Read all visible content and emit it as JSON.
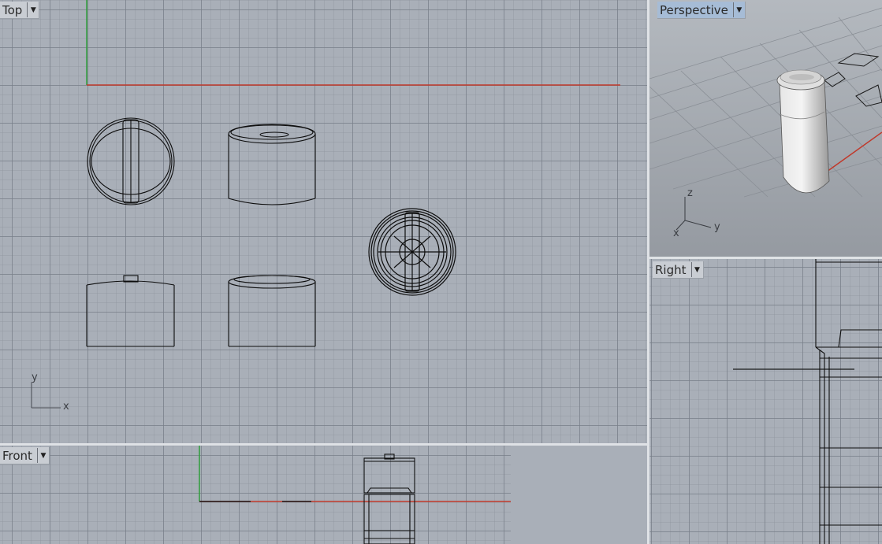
{
  "viewports": {
    "top": {
      "label": "Top",
      "axis_x": "x",
      "axis_y": "y"
    },
    "front": {
      "label": "Front"
    },
    "perspective": {
      "label": "Perspective",
      "axis_x": "x",
      "axis_y": "y",
      "axis_z": "z"
    },
    "right": {
      "label": "Right"
    }
  },
  "icons": {
    "dropdown": "dropdown-arrow-icon"
  },
  "colors": {
    "x_axis": "#c0392b",
    "y_axis": "#2e9e3a",
    "wire": "#0d0d0d",
    "active_label": "#a6bcd6",
    "viewport_bg": "#a9afb8"
  }
}
